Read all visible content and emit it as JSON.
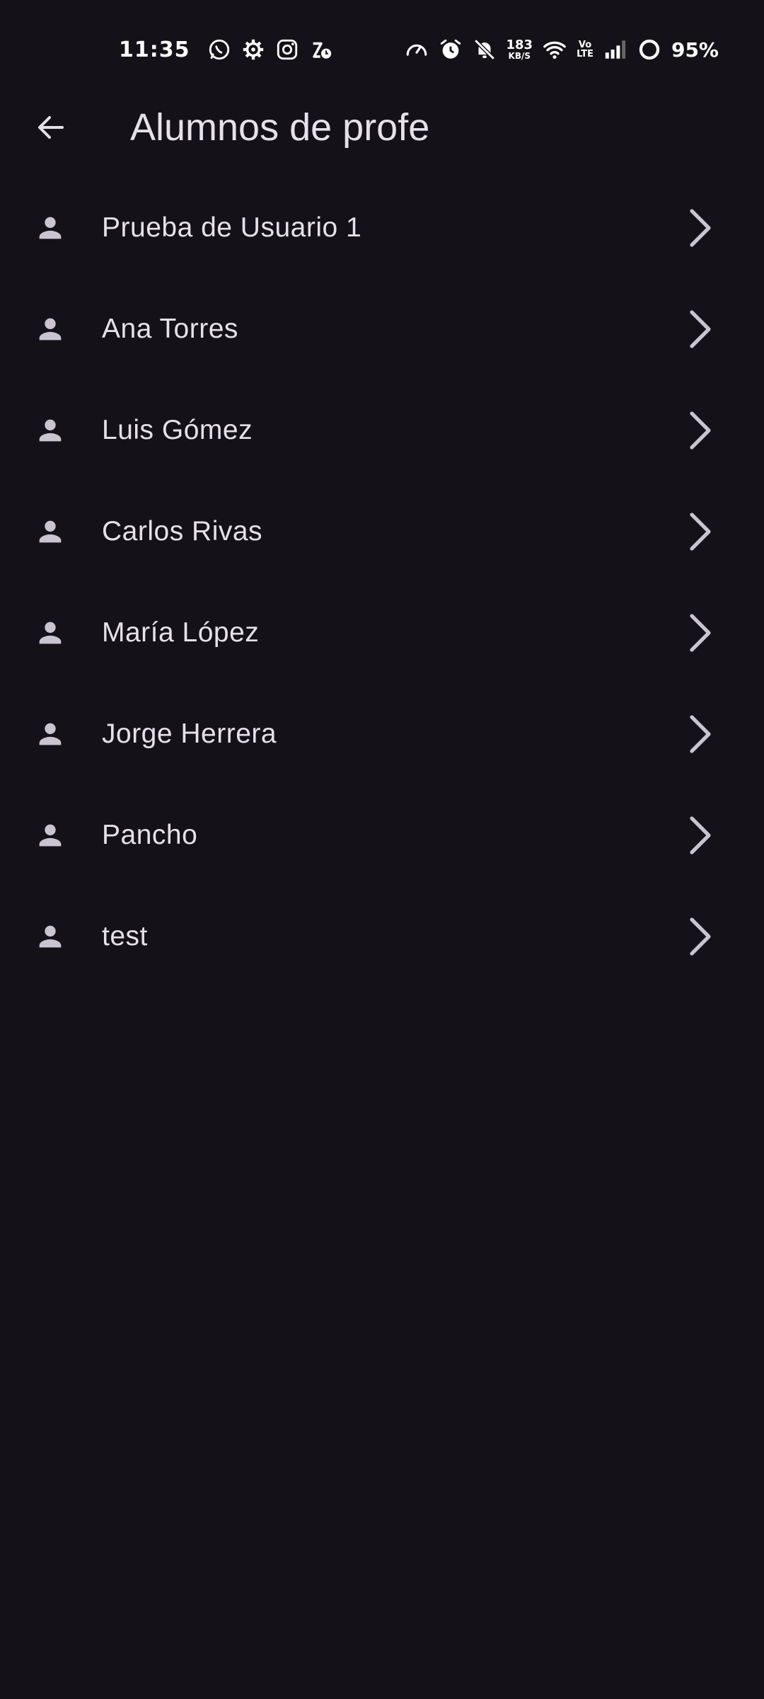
{
  "status_bar": {
    "time": "11:35",
    "left_icons": [
      "whatsapp-icon",
      "settings-gear-icon",
      "instagram-icon",
      "app-notification-icon"
    ],
    "right_icons": [
      "speedometer-icon",
      "alarm-icon",
      "notifications-off-icon",
      "netspeed",
      "wifi-icon",
      "volte-icon",
      "signal-icon",
      "battery-icon"
    ],
    "net_speed_value": "183",
    "net_speed_unit": "KB/S",
    "volte_top": "Vo",
    "volte_bottom": "LTE",
    "battery": "95%"
  },
  "app_bar": {
    "back_icon": "arrow-back-icon",
    "title": "Alumnos de profe"
  },
  "students": [
    {
      "name": "Prueba de Usuario 1"
    },
    {
      "name": "Ana Torres"
    },
    {
      "name": "Luis Gómez"
    },
    {
      "name": "Carlos Rivas"
    },
    {
      "name": "María López"
    },
    {
      "name": "Jorge Herrera"
    },
    {
      "name": "Pancho"
    },
    {
      "name": "test"
    }
  ],
  "colors": {
    "background": "#141218",
    "text": "#E6E0E9",
    "icon": "#CAC4D0"
  }
}
